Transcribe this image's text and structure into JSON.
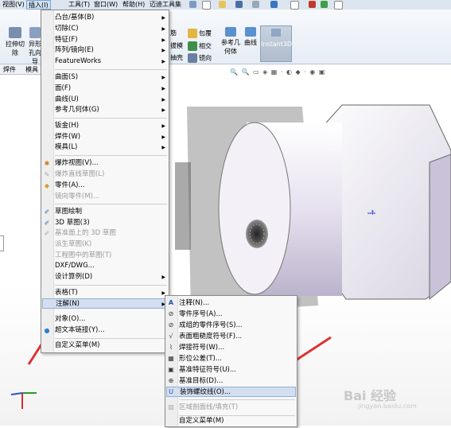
{
  "menubar": {
    "items": [
      "视图(V)",
      "插入(I)",
      "工具(T)",
      "窗口(W)",
      "帮助(H)",
      "迈迪工具集"
    ],
    "active_index": 1
  },
  "ribbon": {
    "left_buttons": [
      "拉伸切除",
      "异形孔向导"
    ],
    "mid_buttons": [
      "筋",
      "拔模",
      "抽壳",
      "包覆",
      "相交",
      "镜向"
    ],
    "ref_button": "参考几何体",
    "curve_button": "曲线",
    "instant3d": "Instant3D"
  },
  "tabs": [
    "焊件",
    "模具"
  ],
  "insert_menu": {
    "items": [
      {
        "label": "凸台/基体(B)",
        "arrow": true,
        "disabled": false
      },
      {
        "label": "切除(C)",
        "arrow": true,
        "disabled": false
      },
      {
        "label": "特征(F)",
        "arrow": true,
        "disabled": false
      },
      {
        "label": "阵列/镜向(E)",
        "arrow": true,
        "disabled": false
      },
      {
        "label": "FeatureWorks",
        "arrow": true,
        "disabled": false
      },
      {
        "label": "曲面(S)",
        "arrow": true,
        "disabled": false
      },
      {
        "label": "面(F)",
        "arrow": true,
        "disabled": false
      },
      {
        "label": "曲线(U)",
        "arrow": true,
        "disabled": false
      },
      {
        "label": "参考几何体(G)",
        "arrow": true,
        "disabled": false
      },
      {
        "label": "钣金(H)",
        "arrow": true,
        "disabled": false
      },
      {
        "label": "焊件(W)",
        "arrow": true,
        "disabled": false
      },
      {
        "label": "模具(L)",
        "arrow": true,
        "disabled": false
      },
      {
        "label": "爆炸视图(V)...",
        "arrow": false,
        "disabled": false
      },
      {
        "label": "爆炸直线草图(L)",
        "arrow": false,
        "disabled": true
      },
      {
        "label": "零件(A)...",
        "arrow": false,
        "disabled": false
      },
      {
        "label": "镜向零件(M)...",
        "arrow": false,
        "disabled": true
      },
      {
        "label": "草图绘制",
        "arrow": false,
        "disabled": false
      },
      {
        "label": "3D 草图(3)",
        "arrow": false,
        "disabled": false
      },
      {
        "label": "基准面上的 3D 草图",
        "arrow": false,
        "disabled": true
      },
      {
        "label": "派生草图(K)",
        "arrow": false,
        "disabled": true
      },
      {
        "label": "工程图中的草图(T)",
        "arrow": false,
        "disabled": true
      },
      {
        "label": "DXF/DWG...",
        "arrow": false,
        "disabled": false
      },
      {
        "label": "设计算例(D)",
        "arrow": true,
        "disabled": false
      },
      {
        "label": "表格(T)",
        "arrow": true,
        "disabled": false
      },
      {
        "label": "注解(N)",
        "arrow": true,
        "disabled": false
      },
      {
        "label": "对象(O)...",
        "arrow": false,
        "disabled": false
      },
      {
        "label": "超文本链接(Y)...",
        "arrow": false,
        "disabled": false
      },
      {
        "label": "自定义菜单(M)",
        "arrow": false,
        "disabled": false
      }
    ]
  },
  "annotation_menu": {
    "items": [
      {
        "label": "注释(N)...",
        "icon": "A",
        "disabled": false
      },
      {
        "label": "零件序号(A)...",
        "icon": "⊘",
        "disabled": false
      },
      {
        "label": "成组的零件序号(S)...",
        "icon": "⊘",
        "disabled": false
      },
      {
        "label": "表面粗糙度符号(F)...",
        "icon": "√",
        "disabled": false
      },
      {
        "label": "焊接符号(W)...",
        "icon": "⌇",
        "disabled": false
      },
      {
        "label": "形位公差(T)...",
        "icon": "▦",
        "disabled": false
      },
      {
        "label": "基准特征符号(U)...",
        "icon": "▣",
        "disabled": false
      },
      {
        "label": "基准目标(D)...",
        "icon": "⊕",
        "disabled": false
      },
      {
        "label": "装饰螺纹线(O)...",
        "icon": "U",
        "disabled": false
      },
      {
        "label": "区域剖面线/填充(T)",
        "icon": "▨",
        "disabled": true
      },
      {
        "label": "自定义菜单(M)",
        "icon": "",
        "disabled": false
      }
    ]
  },
  "watermark": {
    "brand": "Bai 经验",
    "url": "jingyan.baidu.com"
  },
  "colors": {
    "arrow": "#e03030",
    "menu_highlight": "#d3def0",
    "menubar": "#dde6f0"
  }
}
